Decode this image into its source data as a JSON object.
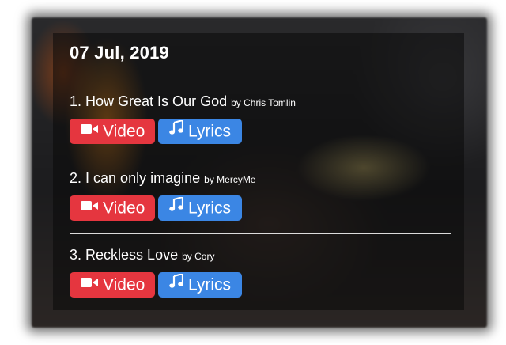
{
  "header": {
    "date": "07 Jul, 2019"
  },
  "songs": [
    {
      "number": "1.",
      "title": "How Great Is Our God",
      "artist": "by Chris Tomlin",
      "video_label": "Video",
      "lyrics_label": "Lyrics"
    },
    {
      "number": "2.",
      "title": "I can only imagine",
      "artist": "by MercyMe",
      "video_label": "Video",
      "lyrics_label": "Lyrics"
    },
    {
      "number": "3.",
      "title": "Reckless Love",
      "artist": "by Cory",
      "video_label": "Video",
      "lyrics_label": "Lyrics"
    }
  ],
  "icons": {
    "video": "video-camera-icon",
    "lyrics": "music-note-icon"
  },
  "colors": {
    "video_button": "#e5363f",
    "lyrics_button": "#3b86e4",
    "text": "#ffffff"
  }
}
